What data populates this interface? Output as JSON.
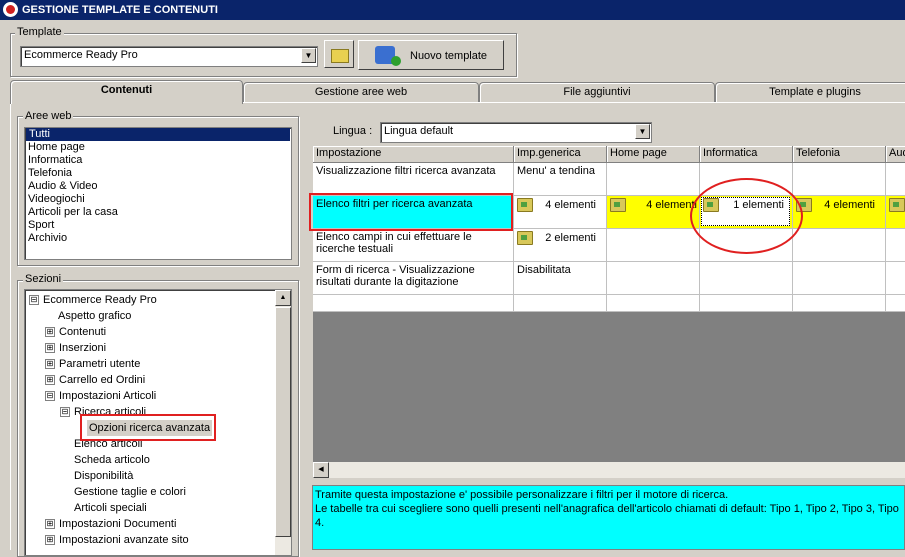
{
  "window": {
    "title": "GESTIONE TEMPLATE E CONTENUTI"
  },
  "template": {
    "label": "Template",
    "selected": "Ecommerce Ready Pro",
    "new_button": "Nuovo template"
  },
  "tabs": [
    "Contenuti",
    "Gestione aree web",
    "File aggiuntivi",
    "Template e plugins"
  ],
  "aree_web": {
    "label": "Aree web",
    "items": [
      "Tutti",
      "Home page",
      "Informatica",
      "Telefonia",
      "Audio & Video",
      "Videogiochi",
      "Articoli per la casa",
      "Sport",
      "Archivio"
    ]
  },
  "sezioni": {
    "label": "Sezioni",
    "tree": [
      {
        "label": "Ecommerce Ready Pro",
        "expander": "⊟"
      },
      {
        "label": "Aspetto grafico",
        "expander": ""
      },
      {
        "label": "Contenuti",
        "expander": "⊞"
      },
      {
        "label": "Inserzioni",
        "expander": "⊞"
      },
      {
        "label": "Parametri utente",
        "expander": "⊞"
      },
      {
        "label": "Carrello ed Ordini",
        "expander": "⊞"
      },
      {
        "label": "Impostazioni Articoli",
        "expander": "⊟"
      },
      {
        "label": "Ricerca articoli",
        "expander": "⊟"
      },
      {
        "label": "Opzioni ricerca avanzata",
        "expander": ""
      },
      {
        "label": "Elenco articoli",
        "expander": ""
      },
      {
        "label": "Scheda articolo",
        "expander": ""
      },
      {
        "label": "Disponibilità",
        "expander": ""
      },
      {
        "label": "Gestione taglie e colori",
        "expander": ""
      },
      {
        "label": "Articoli speciali",
        "expander": ""
      },
      {
        "label": "Impostazioni Documenti",
        "expander": "⊞"
      },
      {
        "label": "Impostazioni avanzate sito",
        "expander": "⊞"
      }
    ]
  },
  "lingua": {
    "label": "Lingua :",
    "selected": "Lingua default"
  },
  "grid": {
    "headers": [
      "Impostazione",
      "Imp.generica",
      "Home page",
      "Informatica",
      "Telefonia",
      "Aud"
    ],
    "rows": [
      {
        "setting": "Visualizzazione filtri ricerca avanzata",
        "generic": "Menu' a tendina",
        "home": "",
        "info": "",
        "tel": ""
      },
      {
        "setting": "Elenco filtri per ricerca avanzata",
        "generic": "4 elementi",
        "home": "4 elementi",
        "info": "1 elementi",
        "tel": "4 elementi"
      },
      {
        "setting": "Elenco campi in cui effettuare le ricerche testuali",
        "generic": "2 elementi",
        "home": "",
        "info": "",
        "tel": ""
      },
      {
        "setting": "Form di ricerca - Visualizzazione risultati durante la digitazione",
        "generic": "Disabilitata",
        "home": "",
        "info": "",
        "tel": ""
      }
    ]
  },
  "description": {
    "line1": "Tramite questa impostazione e' possibile personalizzare i filtri per il motore di ricerca.",
    "line2": "Le tabelle tra cui scegliere sono quelli presenti nell'anagrafica dell'articolo chiamati di default: Tipo 1, Tipo 2, Tipo 3, Tipo 4."
  },
  "colors": {
    "highlight_cyan": "#00ffff",
    "highlight_yellow": "#ffff00",
    "annotation_red": "#e02020",
    "title_blue": "#0a246a"
  }
}
